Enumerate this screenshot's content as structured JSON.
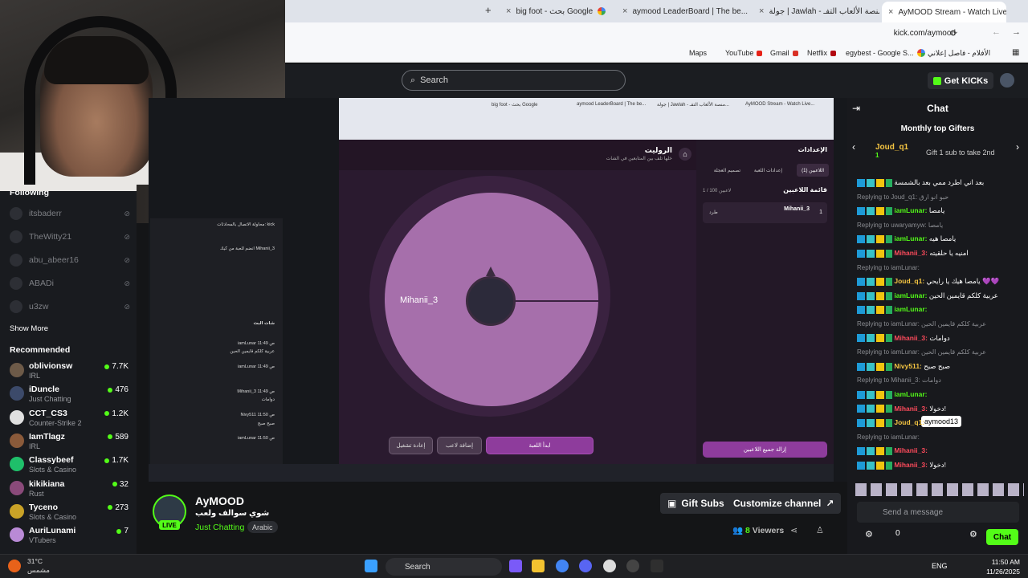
{
  "browser": {
    "tabs": [
      {
        "title": "big foot - بحث Google"
      },
      {
        "title": "aymood LeaderBoard | The be..."
      },
      {
        "title": "جولة | Jawlah - منصة الألعاب التفـ..."
      },
      {
        "title": "AyMOOD Stream - Watch Live..."
      }
    ],
    "new_tab": "+",
    "url": "kick.com/aymood",
    "bookmarks": [
      {
        "label": "Maps"
      },
      {
        "label": "YouTube"
      },
      {
        "label": "Gmail"
      },
      {
        "label": "Netflix"
      },
      {
        "label": "egybest - Google S..."
      },
      {
        "label": "الأفلام - فاصل إعلاني"
      }
    ]
  },
  "header": {
    "search_placeholder": "Search",
    "get_kicks": "Get KICKs"
  },
  "sidebar": {
    "following_title": "Following",
    "following": [
      {
        "name": "itsbaderr"
      },
      {
        "name": "TheWitty21"
      },
      {
        "name": "abu_abeer16"
      },
      {
        "name": "ABADi"
      },
      {
        "name": "u3zw"
      }
    ],
    "show_more": "Show More",
    "recommended_title": "Recommended",
    "recommended": [
      {
        "name": "oblivionsw",
        "category": "IRL",
        "viewers": "7.7K",
        "color": "#6d5a48"
      },
      {
        "name": "iDuncle",
        "category": "Just Chatting",
        "viewers": "476",
        "color": "#3c4a6a"
      },
      {
        "name": "CCT_CS3",
        "category": "Counter-Strike 2",
        "viewers": "1.2K",
        "color": "#e0e0e0"
      },
      {
        "name": "IamTlagz",
        "category": "IRL",
        "viewers": "589",
        "color": "#8a5a3a"
      },
      {
        "name": "Classybeef",
        "category": "Slots & Casino",
        "viewers": "1.7K",
        "color": "#1fbf6a"
      },
      {
        "name": "kikikiana",
        "category": "Rust",
        "viewers": "32",
        "color": "#8a4a7a"
      },
      {
        "name": "Tyceno",
        "category": "Slots & Casino",
        "viewers": "273",
        "color": "#c9a227"
      },
      {
        "name": "AuriLunami",
        "category": "VTubers",
        "viewers": "7",
        "color": "#b98ad6"
      }
    ]
  },
  "game": {
    "title": "الروليت",
    "subtitle": "خلها تلف بين المتابعين في الشات",
    "settings_title": "الإعدادات",
    "tabs": [
      "اللاعبين (1)",
      "إعدادات اللعبة",
      "تصميم العجلة"
    ],
    "players_list_title": "قائمة اللاعبين",
    "players_count": "1 / 100 لاعبين",
    "player": "Mihanii_3",
    "player_num": "1",
    "player_action": "طرد",
    "wheel_label": "Mihanii_3",
    "start_button": "ابدأ اللعبة",
    "add_player_button": "إضافة لاعب",
    "restart_button": "إعادة تشغيل",
    "remove_all_button": "إزالة جميع اللاعبين",
    "left_chat_title": "شات البث",
    "left_chat_msgs": [
      {
        "text": "محاولة الاتصال بالمحادثات: kick"
      },
      {
        "text": "انضم للعبة من كيك Mihanii_3"
      },
      {
        "text": "iamLunar 11:49 ص"
      },
      {
        "text": "عربية كلكم قايمين الحين"
      },
      {
        "text": "iamLunar 11:49 ص"
      },
      {
        "text": "Mihanii_3 11:49 ص"
      },
      {
        "text": "دوامات"
      },
      {
        "text": "Nivy511 11:50 ص"
      },
      {
        "text": "صبح صبح"
      },
      {
        "text": "iamLunar 11:50 ص"
      }
    ]
  },
  "stream": {
    "channel": "AyMOOD",
    "live": "LIVE",
    "title": "شوي سوالف ولعب",
    "category": "Just Chatting",
    "language": "Arabic",
    "gift_subs": "Gift Subs",
    "customize": "Customize channel",
    "viewers_num": "8",
    "viewers_label": "Viewers"
  },
  "chat": {
    "title": "Chat",
    "gifters_title": "Monthly top Gifters",
    "top_gifter": "Joud_q1",
    "top_gifter_count": "1",
    "gift_hint": "Gift 1 sub to take 2nd",
    "messages": [
      {
        "reply": "",
        "user": "",
        "text": "بعد اني اطرد ممي بعد بالشمسة",
        "cls": ""
      },
      {
        "reply": "Replying to Joud_q1: حبو انو ارق",
        "user": "",
        "text": "",
        "cls": ""
      },
      {
        "reply": "",
        "user": "iamLunar:",
        "text": "يامصا",
        "cls": "u-green"
      },
      {
        "reply": "Replying to uwaryamyw: يامصا",
        "user": "",
        "text": "",
        "cls": ""
      },
      {
        "reply": "",
        "user": "iamLunar:",
        "text": "يامصا هيه",
        "cls": "u-green"
      },
      {
        "reply": "",
        "user": "Mihanii_3:",
        "text": "امنيه يا حلقيته",
        "cls": "u-red"
      },
      {
        "reply": "Replying to iamLunar:",
        "user": "",
        "text": "",
        "cls": ""
      },
      {
        "reply": "",
        "user": "Joud_q1:",
        "text": "يامصا هيك يا رايحي 💜💜",
        "cls": "u-yellow"
      },
      {
        "reply": "",
        "user": "iamLunar:",
        "text": "عربية كلكم قايمين الحين",
        "cls": "u-green"
      },
      {
        "reply": "",
        "user": "iamLunar:",
        "text": "",
        "cls": "u-green"
      },
      {
        "reply": "Replying to iamLunar: عربية كلكم قايمين الحين",
        "user": "",
        "text": "",
        "cls": ""
      },
      {
        "reply": "",
        "user": "Mihanii_3:",
        "text": "دوامات",
        "cls": "u-red"
      },
      {
        "reply": "Replying to iamLunar: عربية كلكم قايمين الحين",
        "user": "",
        "text": "",
        "cls": ""
      },
      {
        "reply": "",
        "user": "Nivy511:",
        "text": "صبح صبح",
        "cls": "u-yellow"
      },
      {
        "reply": "Replying to Mihanii_3: دوامات",
        "user": "",
        "text": "",
        "cls": ""
      },
      {
        "reply": "",
        "user": "iamLunar:",
        "text": "",
        "cls": "u-green"
      },
      {
        "reply": "",
        "user": "Mihanii_3:",
        "text": "دخولا!",
        "cls": "u-red"
      },
      {
        "reply": "",
        "user": "Joud_q1:",
        "text": "",
        "cls": "u-yellow"
      },
      {
        "reply": "Replying to iamLunar:",
        "user": "",
        "text": "",
        "cls": ""
      },
      {
        "reply": "",
        "user": "Mihanii_3:",
        "text": "",
        "cls": "u-red"
      },
      {
        "reply": "",
        "user": "Mihanii_3:",
        "text": "دخولا!",
        "cls": "u-red"
      }
    ],
    "tooltip": "aymood13",
    "input_placeholder": "Send a message",
    "send_button": "Chat",
    "kicks_count": "0"
  },
  "taskbar": {
    "temp": "31°C",
    "weather": "مشمس",
    "search": "Search",
    "lang": "ENG",
    "time": "11:50 AM",
    "date": "11/26/2025"
  }
}
